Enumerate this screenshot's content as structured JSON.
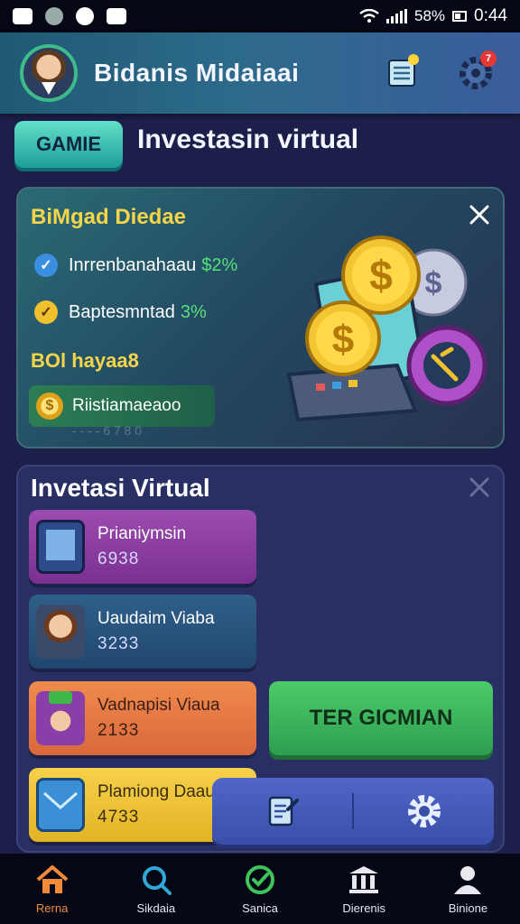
{
  "status_bar": {
    "battery": "58%",
    "time": "0:44"
  },
  "header": {
    "user_name": "Bidanis Midaiaai",
    "notification_count": "7"
  },
  "title_row": {
    "badge": "GAMIE",
    "title": "Investasin virtual"
  },
  "promo_card": {
    "title": "BiMgad Diedae",
    "lines": [
      {
        "label": "Inrrenbanahaau",
        "value": "$2%"
      },
      {
        "label": "Baptesmntad",
        "value": "3%"
      }
    ],
    "subtitle": "BOl hayaa8",
    "pill_label": "Riistiamaeaoo",
    "faint": "- - - - 6 7 8 0"
  },
  "list_card": {
    "title": "Invetasi Virtual",
    "items": [
      {
        "label": "Prianiymsin",
        "value": "6938"
      },
      {
        "label": "Uaudaim Viaba",
        "value": "3233"
      },
      {
        "label": "Vadnapisi Viaua",
        "value": "2133"
      },
      {
        "label": "Plamiong Daau",
        "value": "4733"
      }
    ],
    "cta_label": "TER GICMIAN"
  },
  "bottom_nav": [
    {
      "label": "Rerna",
      "icon": "home-icon"
    },
    {
      "label": "Sikdaia",
      "icon": "search-icon"
    },
    {
      "label": "Sanica",
      "icon": "check-circle-icon"
    },
    {
      "label": "Dierenis",
      "icon": "bank-icon"
    },
    {
      "label": "Binione",
      "icon": "profile-icon"
    }
  ],
  "colors": {
    "accent_yellow": "#f6d54b",
    "accent_green": "#58e07a",
    "nav_active": "#f28a3a",
    "bg": "#1c1f4a"
  }
}
